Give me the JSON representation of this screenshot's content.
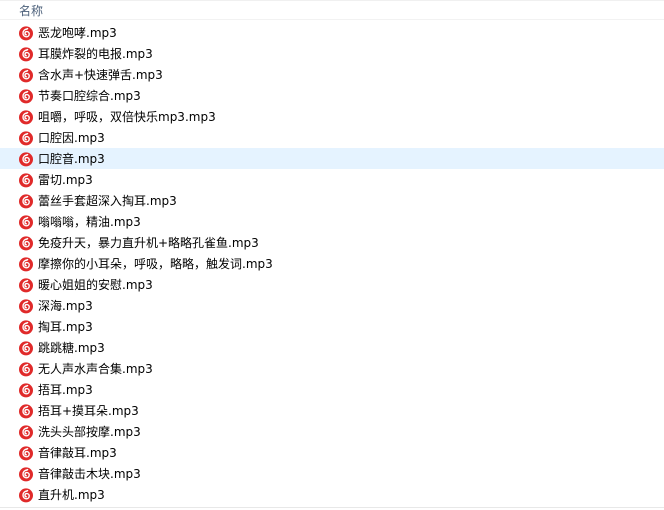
{
  "header": {
    "name_column": "名称"
  },
  "icon": {
    "name": "netease-music-icon",
    "color": "#e02a2a"
  },
  "selection_color": "#e5f3ff",
  "files": [
    {
      "name": "恶龙咆哮.mp3",
      "selected": false
    },
    {
      "name": "耳膜炸裂的电报.mp3",
      "selected": false
    },
    {
      "name": "含水声+快速弹舌.mp3",
      "selected": false
    },
    {
      "name": "节奏口腔综合.mp3",
      "selected": false
    },
    {
      "name": "咀嚼，呼吸，双倍快乐mp3.mp3",
      "selected": false
    },
    {
      "name": "口腔因.mp3",
      "selected": false
    },
    {
      "name": "口腔音.mp3",
      "selected": true
    },
    {
      "name": "雷切.mp3",
      "selected": false
    },
    {
      "name": "蕾丝手套超深入掏耳.mp3",
      "selected": false
    },
    {
      "name": "嗡嗡嗡，精油.mp3",
      "selected": false
    },
    {
      "name": "免疫升天，暴力直升机+略略孔雀鱼.mp3",
      "selected": false
    },
    {
      "name": "摩擦你的小耳朵，呼吸，略略，触发词.mp3",
      "selected": false
    },
    {
      "name": "暖心姐姐的安慰.mp3",
      "selected": false
    },
    {
      "name": "深海.mp3",
      "selected": false
    },
    {
      "name": "掏耳.mp3",
      "selected": false
    },
    {
      "name": "跳跳糖.mp3",
      "selected": false
    },
    {
      "name": "无人声水声合集.mp3",
      "selected": false
    },
    {
      "name": "捂耳.mp3",
      "selected": false
    },
    {
      "name": "捂耳+摸耳朵.mp3",
      "selected": false
    },
    {
      "name": "洗头头部按摩.mp3",
      "selected": false
    },
    {
      "name": "音律敲耳.mp3",
      "selected": false
    },
    {
      "name": "音律敲击木块.mp3",
      "selected": false
    },
    {
      "name": "直升机.mp3",
      "selected": false
    }
  ]
}
